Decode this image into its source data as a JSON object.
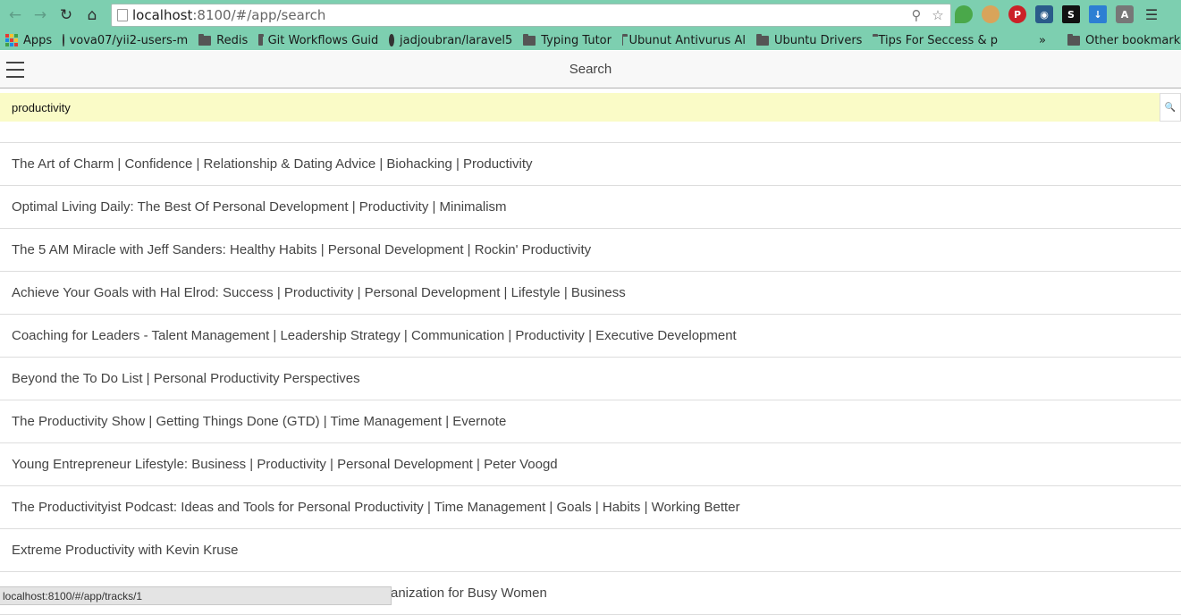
{
  "browser": {
    "url_host": "localhost",
    "url_rest": ":8100/#/app/search",
    "bookmarks": [
      {
        "label": "Apps",
        "type": "apps"
      },
      {
        "label": "vova07/yii2-users-m",
        "type": "github"
      },
      {
        "label": "Redis",
        "type": "folder"
      },
      {
        "label": "Git Workflows Guid",
        "type": "folder"
      },
      {
        "label": "jadjoubran/laravel5",
        "type": "github"
      },
      {
        "label": "Typing Tutor",
        "type": "folder"
      },
      {
        "label": "Ubunut Antivurus Al",
        "type": "folder"
      },
      {
        "label": "Ubuntu Drivers",
        "type": "folder"
      },
      {
        "label": "Tips For Seccess & p",
        "type": "folder"
      }
    ],
    "overflow_label": "»",
    "other_bookmarks": "Other bookmarks",
    "toolbar_color": "#7dcfb0"
  },
  "header": {
    "title": "Search"
  },
  "search": {
    "value": "productivity",
    "input_bg": "#fafbc7"
  },
  "results": [
    "The Art of Charm | Confidence | Relationship & Dating Advice | Biohacking | Productivity",
    "Optimal Living Daily: The Best Of Personal Development | Productivity | Minimalism",
    "The 5 AM Miracle with Jeff Sanders: Healthy Habits | Personal Development | Rockin' Productivity",
    "Achieve Your Goals with Hal Elrod: Success | Productivity | Personal Development | Lifestyle | Business",
    "Coaching for Leaders - Talent Management | Leadership Strategy | Communication | Productivity | Executive Development",
    "Beyond the To Do List | Personal Productivity Perspectives",
    "The Productivity Show | Getting Things Done (GTD) | Time Management | Evernote",
    "Young Entrepreneur Lifestyle: Business | Productivity | Personal Development | Peter Voogd",
    "The Productivityist Podcast: Ideas and Tools for Personal Productivity | Time Management | Goals | Habits | Working Better",
    "Extreme Productivity with Kevin Kruse",
    "anization for Busy Women"
  ],
  "status_bar": {
    "text": "localhost:8100/#/app/tracks/1"
  }
}
